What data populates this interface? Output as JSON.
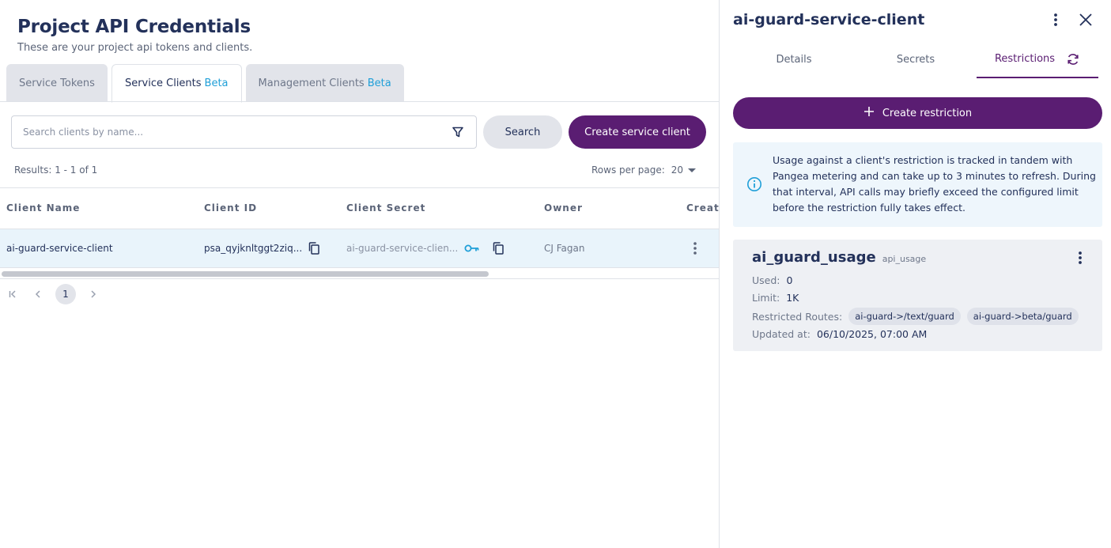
{
  "page": {
    "title": "Project API Credentials",
    "subtitle": "These are your project api tokens and clients."
  },
  "tabs": [
    {
      "label": "Service Tokens",
      "beta": ""
    },
    {
      "label": "Service Clients",
      "beta": "Beta"
    },
    {
      "label": "Management Clients",
      "beta": "Beta"
    }
  ],
  "search": {
    "placeholder": "Search clients by name...",
    "value": "",
    "search_label": "Search",
    "create_label": "Create service client"
  },
  "results_text": "Results: 1 - 1 of 1",
  "rows_per_page": {
    "label": "Rows per page:",
    "value": "20"
  },
  "table": {
    "columns": [
      "Client Name",
      "Client ID",
      "Client Secret",
      "Owner",
      "Creat"
    ],
    "rows": [
      {
        "name": "ai-guard-service-client",
        "client_id": "psa_qyjknltggt2ziq...",
        "secret": "ai-guard-service-clien...",
        "owner": "CJ Fagan"
      }
    ]
  },
  "pagination": {
    "current": "1"
  },
  "drawer": {
    "title": "ai-guard-service-client",
    "tabs": [
      "Details",
      "Secrets",
      "Restrictions"
    ],
    "create_restriction_label": "Create restriction",
    "info": "Usage against a client's restriction is tracked in tandem with Pangea metering and can take up to 3 minutes to refresh. During that interval, API calls may briefly exceed the configured limit before the restriction fully takes effect.",
    "restriction": {
      "name": "ai_guard_usage",
      "type": "api_usage",
      "used_label": "Used:",
      "used": "0",
      "limit_label": "Limit:",
      "limit": "1K",
      "routes_label": "Restricted Routes:",
      "routes": [
        "ai-guard->/text/guard",
        "ai-guard->beta/guard"
      ],
      "updated_label": "Updated at:",
      "updated": "06/10/2025, 07:00 AM"
    }
  },
  "colors": {
    "primary": "#5a1d72",
    "beta": "#1f9fd8",
    "row_highlight": "#e9f4fb",
    "info_bg": "#eef6fc"
  }
}
